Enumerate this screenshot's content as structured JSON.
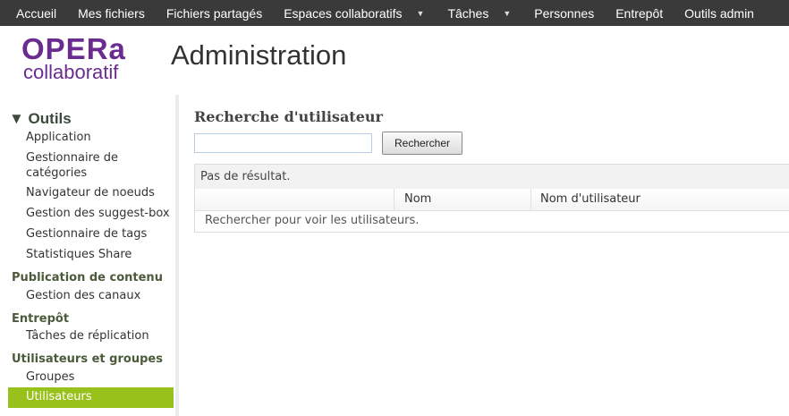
{
  "nav": {
    "items": [
      {
        "label": "Accueil",
        "has_dropdown": false
      },
      {
        "label": "Mes fichiers",
        "has_dropdown": false
      },
      {
        "label": "Fichiers partagés",
        "has_dropdown": false
      },
      {
        "label": "Espaces collaboratifs",
        "has_dropdown": true
      },
      {
        "label": "Tâches",
        "has_dropdown": true
      },
      {
        "label": "Personnes",
        "has_dropdown": false
      },
      {
        "label": "Entrepôt",
        "has_dropdown": false
      },
      {
        "label": "Outils admin",
        "has_dropdown": false
      }
    ],
    "dropdown_icon": "caret-down-icon"
  },
  "logo": {
    "line1": "OPERa",
    "line2": "collaboratif"
  },
  "header": {
    "title": "Administration"
  },
  "sidebar": {
    "heading": "▼ Outils",
    "groups": [
      {
        "title": "",
        "items": [
          "Application",
          "Gestionnaire de catégories",
          "Navigateur de noeuds",
          "Gestion des suggest-box",
          "Gestionnaire de tags",
          "Statistiques Share"
        ]
      },
      {
        "title": "Publication de contenu",
        "items": [
          "Gestion des canaux"
        ]
      },
      {
        "title": "Entrepôt",
        "items": [
          "Tâches de réplication"
        ]
      },
      {
        "title": "Utilisateurs et groupes",
        "items": [
          "Groupes",
          "Utilisateurs"
        ]
      }
    ],
    "active_item": "Utilisateurs"
  },
  "main": {
    "section_title": "Recherche d'utilisateur",
    "search": {
      "value": "",
      "placeholder": ""
    },
    "search_button": "Rechercher",
    "results": {
      "status": "Pas de résultat.",
      "columns": [
        "",
        "Nom",
        "Nom d'utilisateur"
      ],
      "empty_message": "Rechercher pour voir les utilisateurs."
    }
  },
  "colors": {
    "nav_bg": "#3a3a3a",
    "brand": "#6a2c8e",
    "active": "#99c11c"
  }
}
